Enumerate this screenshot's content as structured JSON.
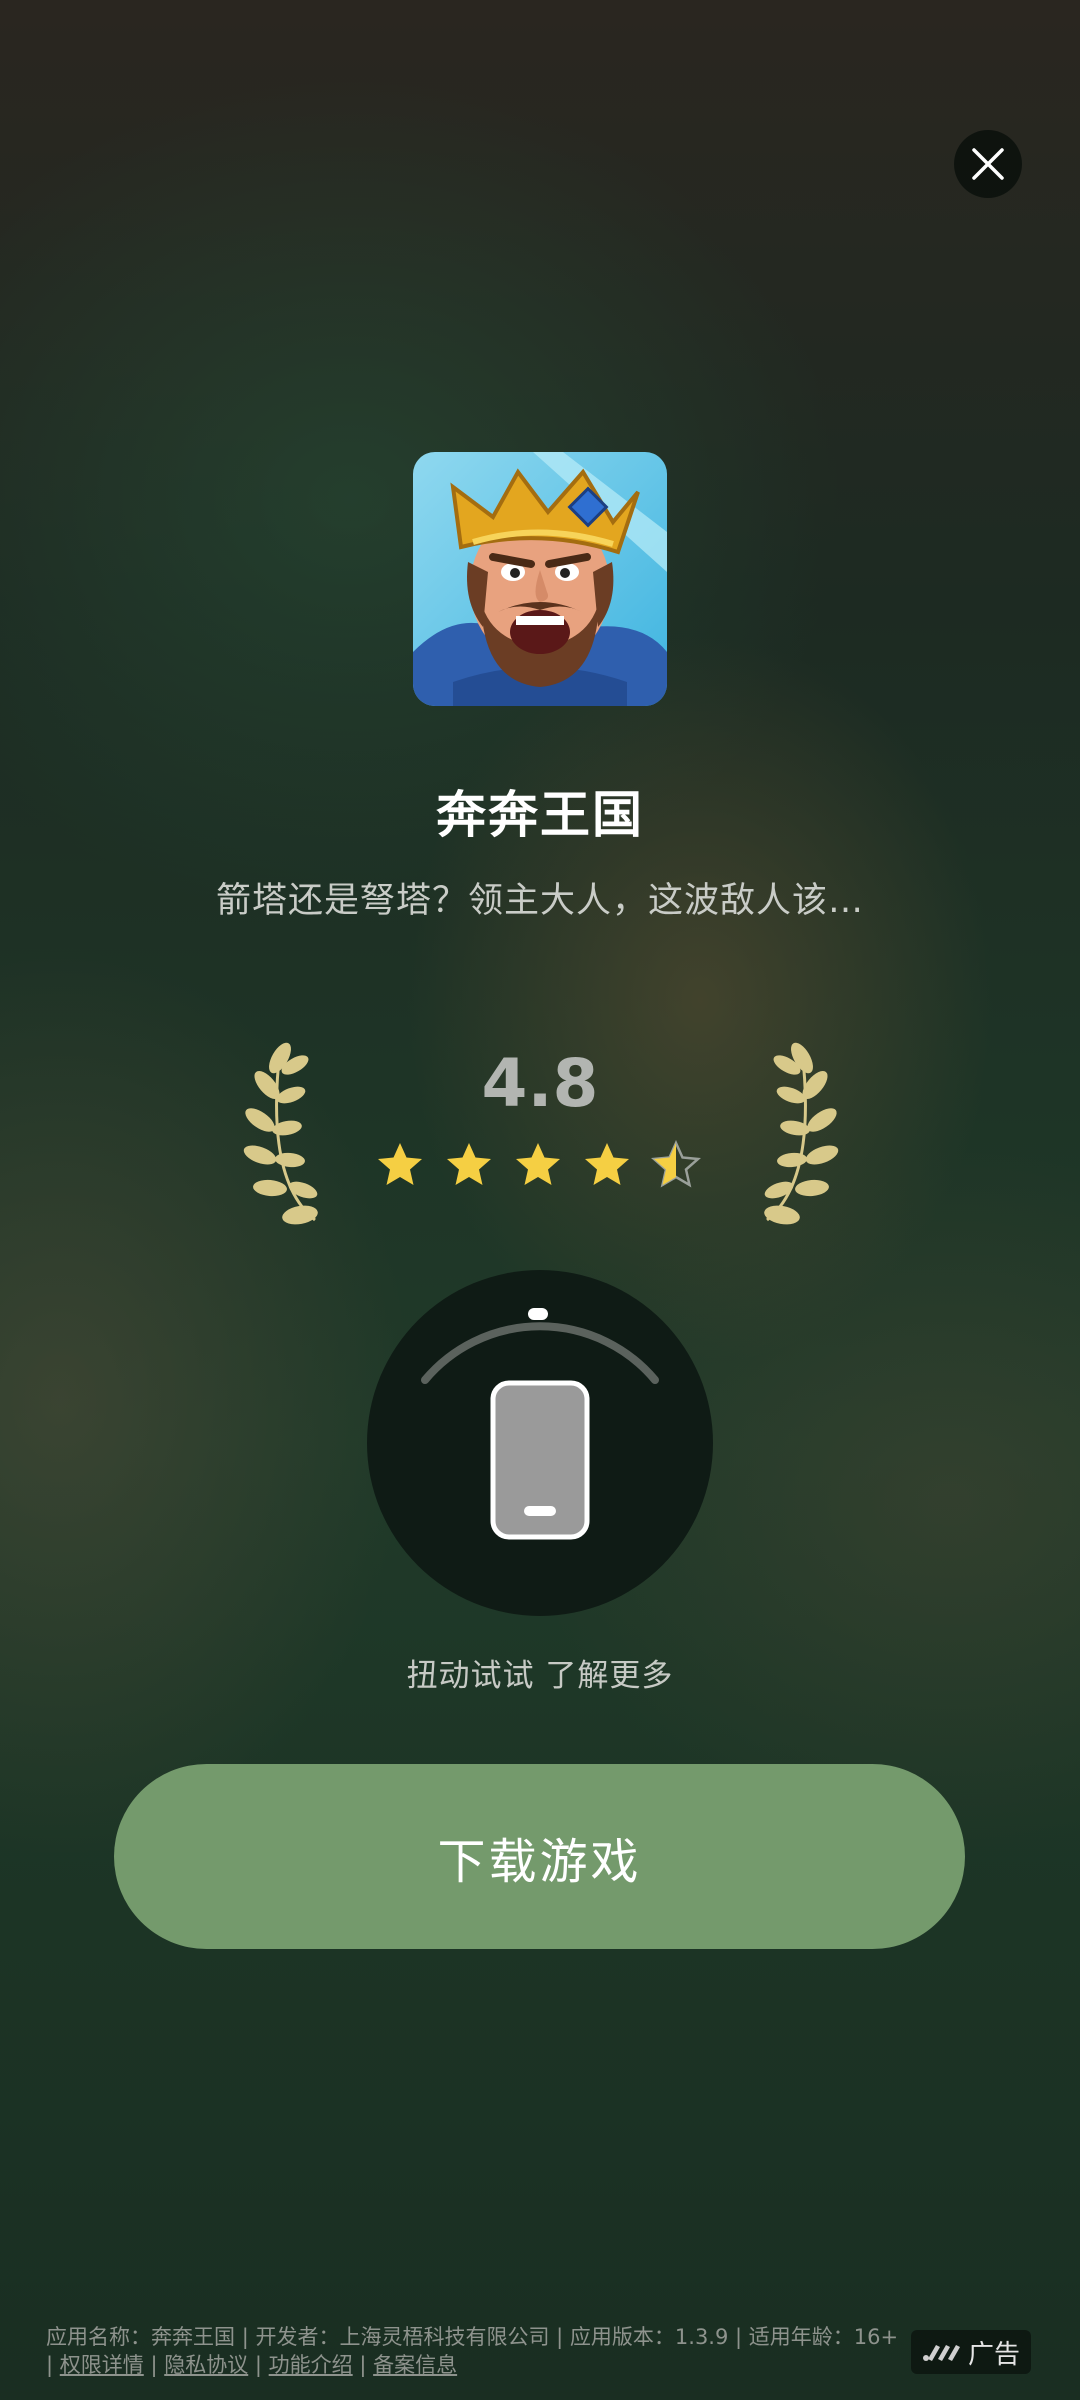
{
  "app": {
    "name": "奔奔王国",
    "description": "箭塔还是弩塔？领主大人，这波敌人该…",
    "rating": "4.8",
    "stars": 4.5
  },
  "twist": {
    "label": "扭动试试 了解更多"
  },
  "download": {
    "label": "下载游戏"
  },
  "footer": {
    "app_name_label": "应用名称：",
    "app_name": "奔奔王国",
    "developer_label": "开发者：",
    "developer": "上海灵梧科技有限公司",
    "version_label": "应用版本：",
    "version": "1.3.9",
    "age_label": "适用年龄：",
    "age": "16+",
    "permissions": "权限详情",
    "privacy": "隐私协议",
    "features": "功能介绍",
    "filing": "备案信息",
    "separator": "|"
  },
  "ad": {
    "label": "广告"
  },
  "colors": {
    "button": "#749a6c",
    "star": "#f5cf43",
    "laurel": "#d8c98a"
  }
}
